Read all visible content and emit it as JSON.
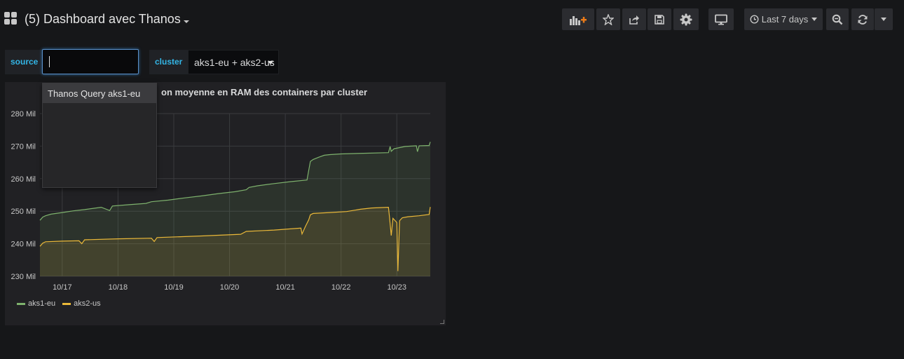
{
  "header": {
    "title": "(5) Dashboard avec Thanos",
    "time_range": "Last 7 days",
    "icons": [
      "add-panel-icon",
      "star-icon",
      "share-icon",
      "save-icon",
      "gear-icon",
      "tv-icon",
      "clock-icon",
      "zoom-out-icon",
      "refresh-icon",
      "chevron-down-icon"
    ]
  },
  "variables": {
    "source_label": "source",
    "source_value": "",
    "cluster_label": "cluster",
    "cluster_value": "aks1-eu + aks2-us"
  },
  "dropdown": {
    "options": [
      "Thanos Query aks1-eu"
    ]
  },
  "panel": {
    "title": "on moyenne en RAM des containers par cluster"
  },
  "chart_data": {
    "type": "line",
    "title": "on moyenne en RAM des containers par cluster",
    "x_ticks": [
      "10/17",
      "10/18",
      "10/19",
      "10/20",
      "10/21",
      "10/22",
      "10/23"
    ],
    "y_ticks": [
      "230 Mil",
      "240 Mil",
      "250 Mil",
      "260 Mil",
      "270 Mil",
      "280 Mil"
    ],
    "ylim": [
      230,
      280
    ],
    "xlim": [
      -0.4,
      6.6
    ],
    "grid": true,
    "fill": true,
    "legend_position": "bottom-left",
    "series": [
      {
        "name": "aks1-eu",
        "color": "#7eb26d",
        "points": [
          [
            -0.4,
            247.2
          ],
          [
            -0.35,
            248.2
          ],
          [
            -0.3,
            248.6
          ],
          [
            -0.2,
            249.1
          ],
          [
            0,
            249.6
          ],
          [
            0.2,
            250.1
          ],
          [
            0.4,
            250.5
          ],
          [
            0.7,
            251.2
          ],
          [
            0.85,
            250.2
          ],
          [
            0.9,
            251.6
          ],
          [
            1.2,
            252.0
          ],
          [
            1.5,
            252.4
          ],
          [
            1.6,
            252.9
          ],
          [
            1.9,
            253.4
          ],
          [
            2.2,
            254.1
          ],
          [
            2.5,
            254.7
          ],
          [
            2.8,
            255.4
          ],
          [
            3.1,
            256.0
          ],
          [
            3.3,
            256.6
          ],
          [
            3.35,
            257.3
          ],
          [
            3.5,
            257.8
          ],
          [
            3.8,
            258.5
          ],
          [
            4.1,
            259.1
          ],
          [
            4.39,
            259.6
          ],
          [
            4.42,
            262.5
          ],
          [
            4.45,
            265.3
          ],
          [
            4.5,
            265.9
          ],
          [
            4.6,
            266.6
          ],
          [
            4.7,
            267.2
          ],
          [
            4.8,
            267.4
          ],
          [
            5.0,
            267.6
          ],
          [
            5.4,
            267.8
          ],
          [
            5.85,
            268.0
          ],
          [
            5.88,
            269.9
          ],
          [
            5.9,
            268.4
          ],
          [
            5.95,
            269.2
          ],
          [
            6.15,
            269.9
          ],
          [
            6.35,
            270.1
          ],
          [
            6.37,
            268.3
          ],
          [
            6.4,
            270.1
          ],
          [
            6.58,
            270.2
          ],
          [
            6.6,
            271.3
          ]
        ]
      },
      {
        "name": "aks2-us",
        "color": "#eab839",
        "points": [
          [
            -0.4,
            239.2
          ],
          [
            -0.35,
            240.2
          ],
          [
            -0.3,
            240.6
          ],
          [
            0,
            240.8
          ],
          [
            0.3,
            240.9
          ],
          [
            0.35,
            240.0
          ],
          [
            0.4,
            241.2
          ],
          [
            1.0,
            241.5
          ],
          [
            1.6,
            241.7
          ],
          [
            1.65,
            240.7
          ],
          [
            1.7,
            241.9
          ],
          [
            2.5,
            242.4
          ],
          [
            3.2,
            242.9
          ],
          [
            3.3,
            243.8
          ],
          [
            3.8,
            244.2
          ],
          [
            4.28,
            244.8
          ],
          [
            4.3,
            243.0
          ],
          [
            4.36,
            245.3
          ],
          [
            4.42,
            247.3
          ],
          [
            4.45,
            248.9
          ],
          [
            4.5,
            249.3
          ],
          [
            4.8,
            249.6
          ],
          [
            5.1,
            249.9
          ],
          [
            5.35,
            250.6
          ],
          [
            5.55,
            251.0
          ],
          [
            5.85,
            251.2
          ],
          [
            5.87,
            248.0
          ],
          [
            5.9,
            242.5
          ],
          [
            5.93,
            247.8
          ],
          [
            6.0,
            246.5
          ],
          [
            6.02,
            231.6
          ],
          [
            6.05,
            247.1
          ],
          [
            6.1,
            248.0
          ],
          [
            6.2,
            248.3
          ],
          [
            6.4,
            248.6
          ],
          [
            6.58,
            249.0
          ],
          [
            6.6,
            251.3
          ]
        ]
      }
    ]
  }
}
